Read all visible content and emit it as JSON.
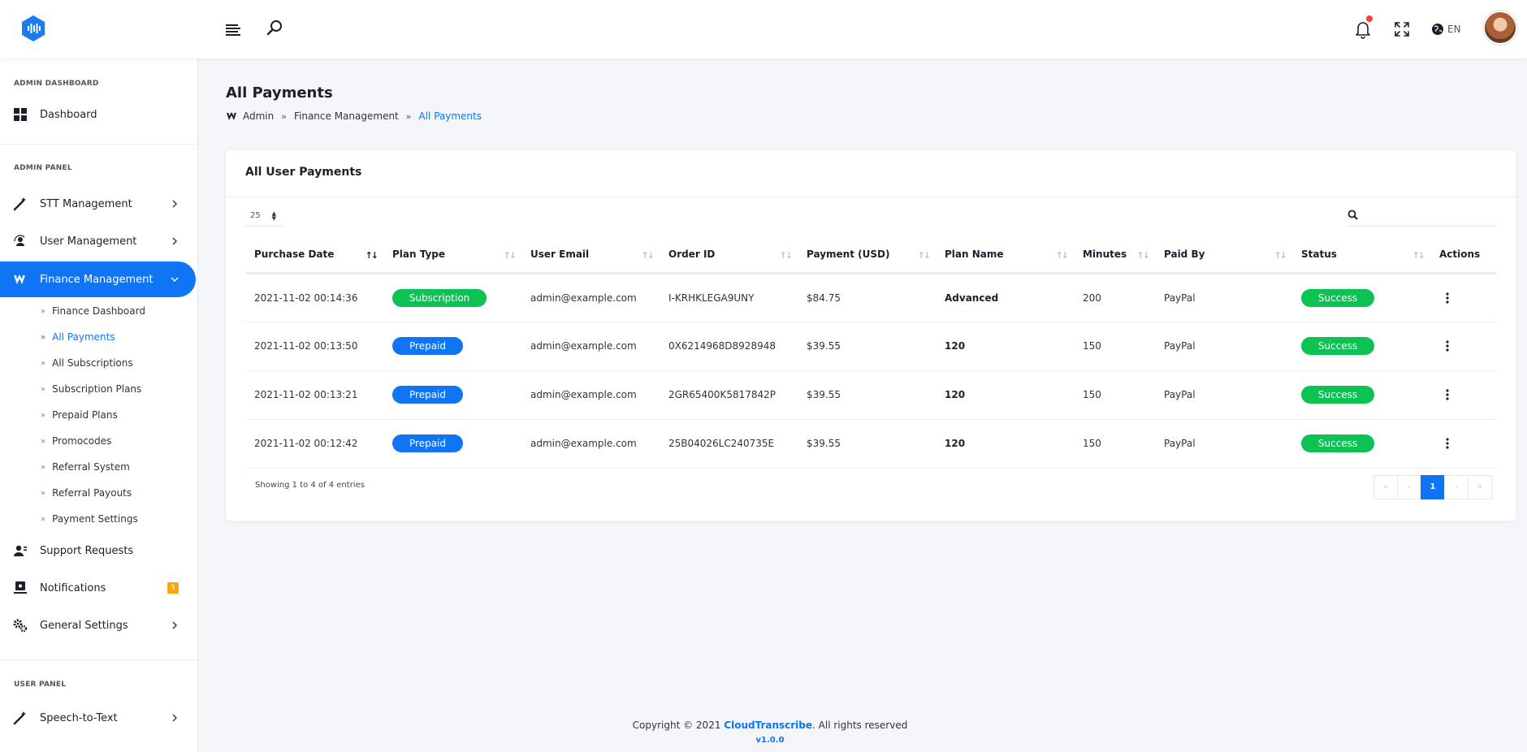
{
  "header": {
    "language": "EN"
  },
  "sidebar": {
    "admin_dashboard_title": "ADMIN DASHBOARD",
    "dashboard": "Dashboard",
    "admin_panel_title": "ADMIN PANEL",
    "stt_management": "STT Management",
    "user_management": "User Management",
    "finance_management": "Finance Management",
    "finance_sub": [
      "Finance Dashboard",
      "All Payments",
      "All Subscriptions",
      "Subscription Plans",
      "Prepaid Plans",
      "Promocodes",
      "Referral System",
      "Referral Payouts",
      "Payment Settings"
    ],
    "support_requests": "Support Requests",
    "notifications": "Notifications",
    "notifications_badge": "5",
    "general_settings": "General Settings",
    "user_panel_title": "USER PANEL",
    "speech_to_text": "Speech-to-Text"
  },
  "page": {
    "title": "All Payments",
    "breadcrumb": [
      "Admin",
      "Finance Management",
      "All Payments"
    ]
  },
  "card": {
    "title": "All User Payments",
    "page_length": "25",
    "columns": [
      "Purchase Date",
      "Plan Type",
      "User Email",
      "Order ID",
      "Payment (USD)",
      "Plan Name",
      "Minutes",
      "Paid By",
      "Status",
      "Actions"
    ],
    "rows": [
      {
        "date": "2021-11-02 00:14:36",
        "plan_type": "Subscription",
        "email": "admin@example.com",
        "order_id": "I-KRHKLEGA9UNY",
        "payment": "$84.75",
        "plan_name": "Advanced",
        "minutes": "200",
        "paid_by": "PayPal",
        "status": "Success"
      },
      {
        "date": "2021-11-02 00:13:50",
        "plan_type": "Prepaid",
        "email": "admin@example.com",
        "order_id": "0X6214968D8928948",
        "payment": "$39.55",
        "plan_name": "120",
        "minutes": "150",
        "paid_by": "PayPal",
        "status": "Success"
      },
      {
        "date": "2021-11-02 00:13:21",
        "plan_type": "Prepaid",
        "email": "admin@example.com",
        "order_id": "2GR65400K5817842P",
        "payment": "$39.55",
        "plan_name": "120",
        "minutes": "150",
        "paid_by": "PayPal",
        "status": "Success"
      },
      {
        "date": "2021-11-02 00:12:42",
        "plan_type": "Prepaid",
        "email": "admin@example.com",
        "order_id": "25B04026LC240735E",
        "payment": "$39.55",
        "plan_name": "120",
        "minutes": "150",
        "paid_by": "PayPal",
        "status": "Success"
      }
    ],
    "info": "Showing 1 to 4 of 4 entries",
    "pagination": {
      "first": "«",
      "prev": "‹",
      "current": "1",
      "next": "›",
      "last": "»"
    }
  },
  "footer": {
    "copyright_prefix": "Copyright © 2021 ",
    "brand": "CloudTranscribe",
    "copyright_suffix": ". All rights reserved",
    "version": "v1.0.0"
  },
  "colors": {
    "accent": "#1075f4",
    "success": "#0bc253",
    "badge": "#f7a70a",
    "notification_dot": "#ff3b3b"
  }
}
